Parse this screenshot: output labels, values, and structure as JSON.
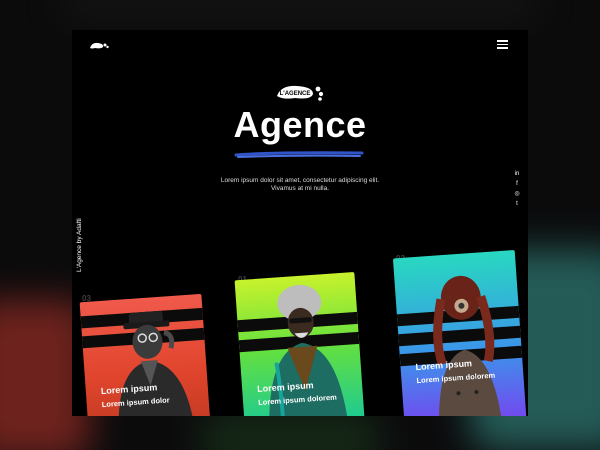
{
  "brand": {
    "badge_text": "L'AGENCE",
    "title": "Agence",
    "description": "Lorem ipsum dolor sit amet, consectetur adipiscing elit. Vivamus at mi nulla."
  },
  "sidebar": {
    "vertical_text": "L'Agence by Adafti"
  },
  "social": [
    "in",
    "f",
    "◎",
    "t"
  ],
  "cards": [
    {
      "number": "03",
      "title": "Lorem ipsum",
      "subtitle": "Lorem ipsum dolor",
      "colors": [
        "#f05a4b",
        "#c23a23"
      ]
    },
    {
      "number": "01",
      "title": "Lorem ipsum",
      "subtitle": "Lorem ipsum dolorem",
      "colors": [
        "#c8f22c",
        "#10c6a1"
      ]
    },
    {
      "number": "02",
      "title": "Lorem ipsum",
      "subtitle": "Lorem ipsum dolorem",
      "colors": [
        "#28d8c0",
        "#7b3df0"
      ]
    }
  ],
  "icons": {
    "logo": "footprint-logo-icon",
    "menu": "hamburger-menu-icon"
  }
}
